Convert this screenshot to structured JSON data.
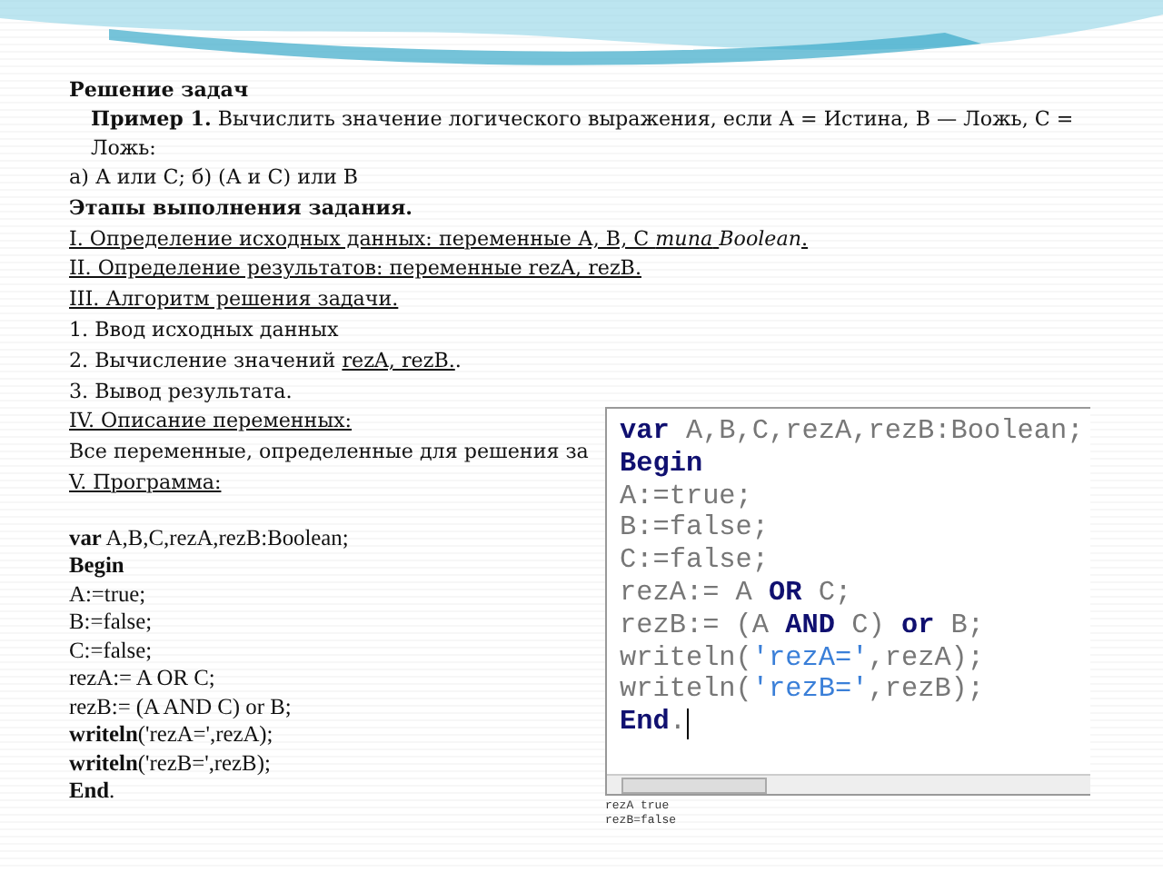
{
  "lesson": {
    "title": "Решение задач",
    "example": {
      "label": "Пример 1.",
      "text": "Вычислить значение логического выражения, если А = Истина, В — Ложь, С = Ложь:"
    },
    "lines": [
      {
        "kind": "plain",
        "segments": [
          {
            "text": "а) А или С; б) (А и С) или В",
            "underlined": false
          }
        ]
      },
      {
        "kind": "heading",
        "segments": [
          {
            "text": "Этапы выполнения задания.",
            "underlined": false
          }
        ]
      },
      {
        "kind": "plain",
        "segments": [
          {
            "text": "I. Определение исходных данных: переменные А, В, С *типа* ",
            "underlined": true
          },
          {
            "text": "*Boolean*",
            "underlined": false
          },
          {
            "text": ".",
            "underlined": true
          }
        ]
      },
      {
        "kind": "plain",
        "segments": [
          {
            "text": "II. Определение результатов: переменные rezA, rezB.",
            "underlined": true
          }
        ]
      },
      {
        "kind": "plain",
        "segments": [
          {
            "text": "III. Алгоритм решения задачи.",
            "underlined": true
          }
        ]
      },
      {
        "kind": "plain",
        "segments": [
          {
            "text": "1. Ввод исходных данных",
            "underlined": false
          }
        ]
      },
      {
        "kind": "plain",
        "segments": [
          {
            "text": "2. Вычисление значений ",
            "underlined": false
          },
          {
            "text": "rezA, rezB.",
            "underlined": true
          },
          {
            "text": ".",
            "underlined": false
          }
        ]
      },
      {
        "kind": "plain",
        "segments": [
          {
            "text": "3. Вывод результата.",
            "underlined": false
          }
        ]
      },
      {
        "kind": "plain",
        "segments": [
          {
            "text": "IV. Описание переменных:",
            "underlined": true
          }
        ]
      },
      {
        "kind": "plain",
        "segments": [
          {
            "text": "Все переменные, определенные для решения за",
            "underlined": false
          }
        ]
      },
      {
        "kind": "plain",
        "segments": [
          {
            "text": "V.  Программа:",
            "underlined": true
          }
        ]
      }
    ],
    "program": [
      "**var** A,B,C,rezA,rezB:Boolean;",
      "**Begin**",
      "A:=true;",
      "B:=false;",
      "C:=false;",
      "rezA:= A OR C;",
      "rezB:= (A AND C) or B;",
      "**writeln**('rezA=',rezA);",
      "**writeln**('rezB=',rezB);",
      "**End**."
    ]
  },
  "editor": {
    "lines": [
      [
        {
          "kind": "keyword",
          "text": "var"
        },
        {
          "kind": "plain",
          "text": " A,B,C,rezA,rezB:Boolean;"
        }
      ],
      [
        {
          "kind": "keyword",
          "text": "Begin"
        }
      ],
      [
        {
          "kind": "plain",
          "text": "A:=true;"
        }
      ],
      [
        {
          "kind": "plain",
          "text": "B:=false;"
        }
      ],
      [
        {
          "kind": "plain",
          "text": "C:=false;"
        }
      ],
      [
        {
          "kind": "plain",
          "text": "rezA:= A "
        },
        {
          "kind": "keyword",
          "text": "OR"
        },
        {
          "kind": "plain",
          "text": " C;"
        }
      ],
      [
        {
          "kind": "plain",
          "text": "rezB:= (A "
        },
        {
          "kind": "keyword",
          "text": "AND"
        },
        {
          "kind": "plain",
          "text": " C) "
        },
        {
          "kind": "keyword",
          "text": "or"
        },
        {
          "kind": "plain",
          "text": " B;"
        }
      ],
      [
        {
          "kind": "plain",
          "text": "writeln("
        },
        {
          "kind": "string",
          "text": "'rezA='"
        },
        {
          "kind": "plain",
          "text": ",rezA);"
        }
      ],
      [
        {
          "kind": "plain",
          "text": "writeln("
        },
        {
          "kind": "string",
          "text": "'rezB='"
        },
        {
          "kind": "plain",
          "text": ",rezB);"
        }
      ],
      [
        {
          "kind": "keyword",
          "text": "End"
        },
        {
          "kind": "plain",
          "text": "."
        }
      ]
    ],
    "output": [
      "rezA true",
      "rezB=false"
    ]
  }
}
